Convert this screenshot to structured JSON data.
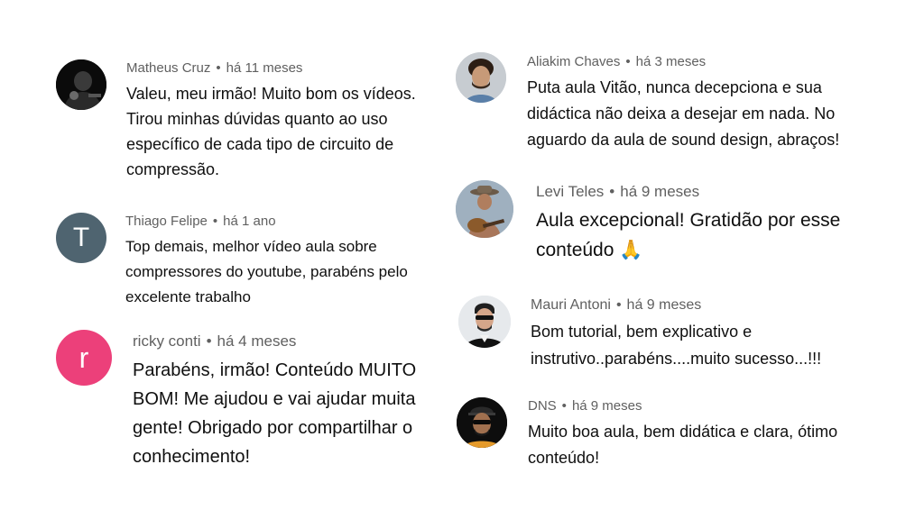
{
  "comments": [
    {
      "author": "Matheus Cruz",
      "time": "há 11 meses",
      "text": "Valeu, meu irmão! Muito bom os vídeos. Tirou minhas dúvidas quanto ao uso específico de cada tipo de circuito de compressão.",
      "avatar": {
        "type": "photo",
        "icon": "dark-photo-avatar"
      }
    },
    {
      "author": "Thiago Felipe",
      "time": "há 1 ano",
      "text": "Top demais, melhor vídeo aula sobre compressores do youtube, parabéns pelo excelente trabalho",
      "avatar": {
        "type": "letter",
        "letter": "T",
        "color": "#4f6470"
      }
    },
    {
      "author": "ricky conti",
      "time": "há 4 meses",
      "text": "Parabéns, irmão! Conteúdo MUITO BOM! Me ajudou e vai ajudar muita gente! Obrigado por compartilhar o conhecimento!",
      "avatar": {
        "type": "letter",
        "letter": "r",
        "color": "#ec407a"
      }
    },
    {
      "author": "Aliakim Chaves",
      "time": "há 3 meses",
      "text": "Puta aula Vitão, nunca decepciona e sua didáctica não deixa a desejar em nada. No aguardo da aula de sound design, abraços!",
      "avatar": {
        "type": "photo",
        "icon": "curly-hair-photo-avatar"
      }
    },
    {
      "author": "Levi Teles",
      "time": "há 9 meses",
      "text": "Aula excepcional! Gratidão por esse conteúdo 🙏",
      "avatar": {
        "type": "photo",
        "icon": "guitar-hat-photo-avatar"
      }
    },
    {
      "author": "Mauri Antoni",
      "time": "há 9 meses",
      "text": "Bom tutorial, bem  explicativo e instrutivo..parabéns....muito sucesso...!!!",
      "avatar": {
        "type": "photo",
        "icon": "sunglasses-photo-avatar"
      }
    },
    {
      "author": "DNS",
      "time": "há 9 meses",
      "text": "Muito boa aula, bem didática e clara, ótimo conteúdo!",
      "avatar": {
        "type": "photo",
        "icon": "cap-sunglasses-photo-avatar"
      }
    }
  ]
}
